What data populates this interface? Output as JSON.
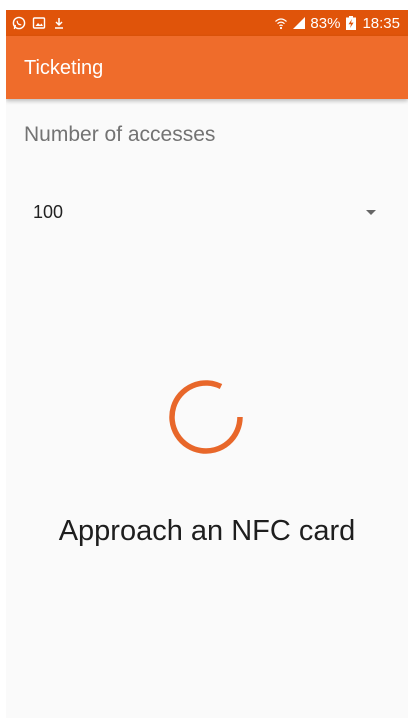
{
  "status_bar": {
    "left_icons": [
      "whatsapp-icon",
      "gallery-icon",
      "download-icon"
    ],
    "right_icons": [
      "wifi-icon",
      "signal-icon",
      "battery-charging-icon"
    ],
    "battery_percent": "83%",
    "time": "18:35"
  },
  "app_bar": {
    "title": "Ticketing"
  },
  "form": {
    "accesses_label": "Number of accesses",
    "accesses_value": "100",
    "accesses_icon": "dropdown-arrow-icon"
  },
  "nfc": {
    "spinner_icon": "progress-spinner-icon",
    "message": "Approach an NFC card"
  },
  "colors": {
    "status_bar": "#e0540a",
    "app_bar": "#ef6c2b",
    "accent": "#e8672a",
    "background": "#fafafa"
  }
}
